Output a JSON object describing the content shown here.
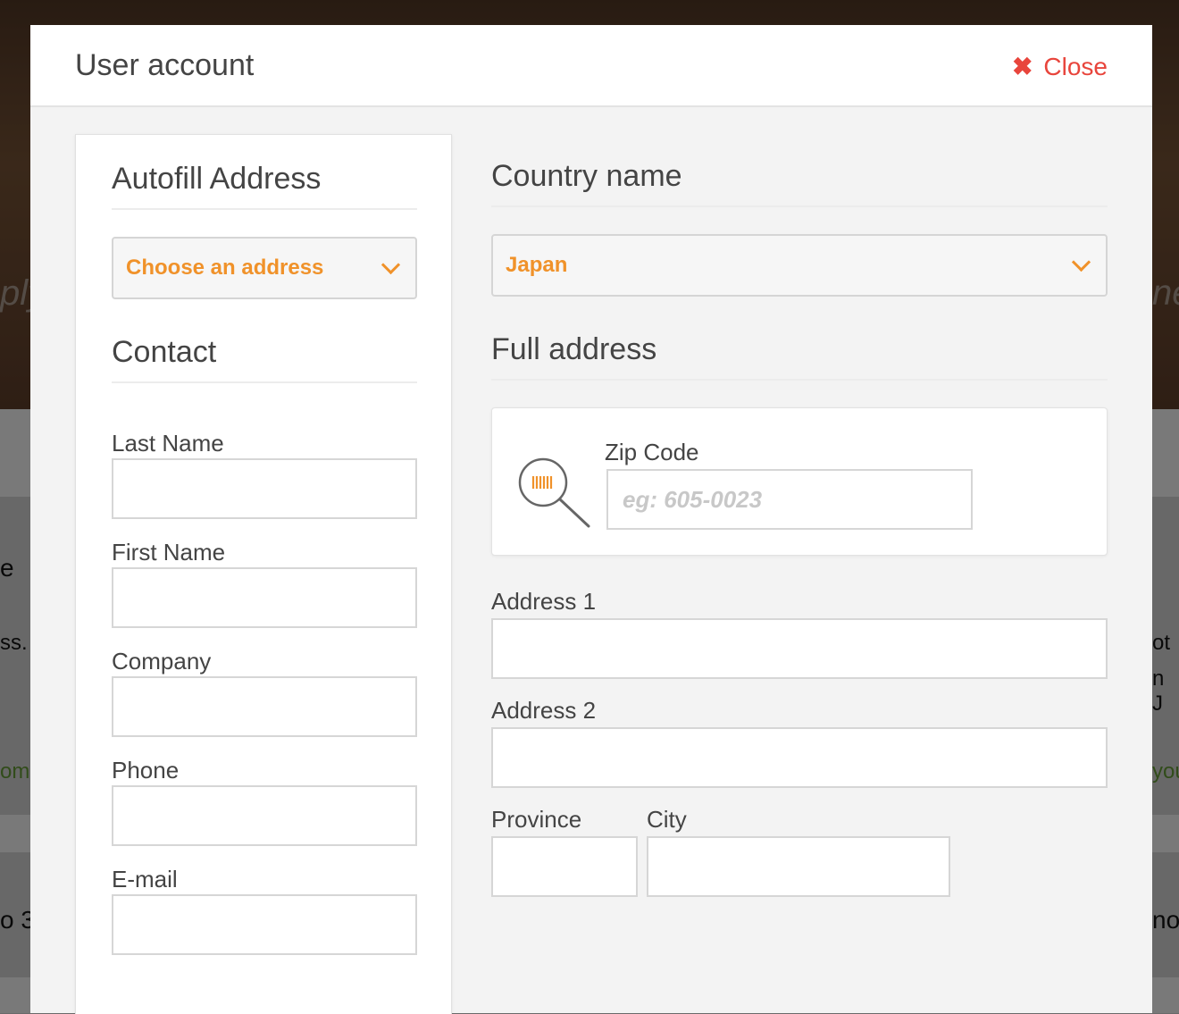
{
  "background": {
    "fragments": [
      "ply",
      "ne",
      "e",
      "ss.",
      "ot",
      "n J",
      "om",
      "you",
      "o 3",
      "no"
    ]
  },
  "modal": {
    "title": "User account",
    "close_label": "Close"
  },
  "left": {
    "autofill_title": "Autofill Address",
    "autofill_select": "Choose an address",
    "contact_title": "Contact",
    "fields": {
      "last_name": {
        "label": "Last Name",
        "value": ""
      },
      "first_name": {
        "label": "First Name",
        "value": ""
      },
      "company": {
        "label": "Company",
        "value": ""
      },
      "phone": {
        "label": "Phone",
        "value": ""
      },
      "email": {
        "label": "E-mail",
        "value": ""
      }
    }
  },
  "right": {
    "country_title": "Country name",
    "country_select": "Japan",
    "full_address_title": "Full address",
    "zip": {
      "label": "Zip Code",
      "placeholder": "eg: 605-0023",
      "value": ""
    },
    "address1": {
      "label": "Address 1",
      "value": ""
    },
    "address2": {
      "label": "Address 2",
      "value": ""
    },
    "province": {
      "label": "Province",
      "value": ""
    },
    "city": {
      "label": "City",
      "value": ""
    }
  },
  "colors": {
    "accent": "#f0922a",
    "close": "#e8453c"
  },
  "icons": {
    "close": "close-x-icon",
    "zip": "barcode-magnifier-icon",
    "dropdown": "chevron-down-icon"
  }
}
